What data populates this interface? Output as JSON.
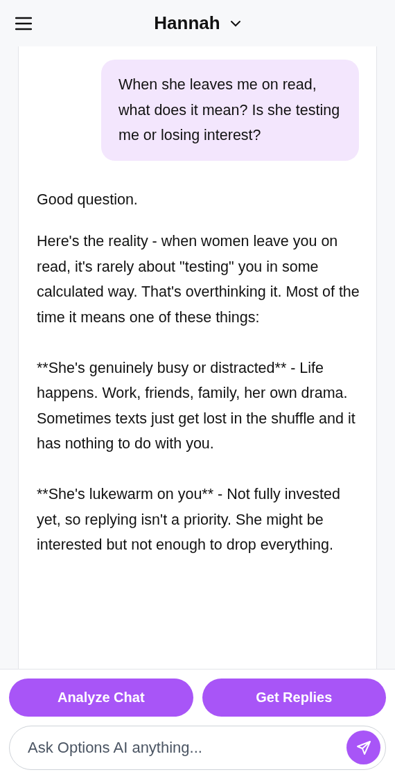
{
  "header": {
    "title": "Hannah"
  },
  "messages": [
    {
      "kind": "user",
      "paragraphs": [
        "When she leaves me on read, what does it mean? Is she testing me or losing interest?"
      ]
    },
    {
      "kind": "assistant",
      "paragraphs": [
        "Good question.",
        "Here's the reality - when women leave you on read, it's rarely about \"testing\" you in some calculated way. That's overthinking it. Most of the time it means one of these things:",
        "**She's genuinely busy or distracted** - Life happens. Work, friends, family, her own drama. Sometimes texts just get lost in the shuffle and it has nothing to do with you.",
        "**She's lukewarm on you** - Not fully invested yet, so replying isn't a priority. She might be interested but not enough to drop everything."
      ]
    }
  ],
  "actions": [
    "Analyze Chat",
    "Get Replies"
  ],
  "composer": {
    "placeholder": "Ask Options AI anything..."
  }
}
